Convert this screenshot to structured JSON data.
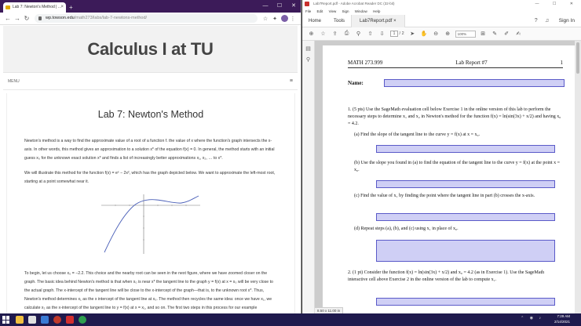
{
  "browser": {
    "tab_title": "Lab 7: Newton's Method | ...",
    "tab_close": "×",
    "new_tab": "+",
    "url_host": "wp.towson.edu",
    "url_path": "/math273/labs/lab-7-newtons-method/",
    "win_min": "—",
    "win_max": "☐",
    "win_close": "✕"
  },
  "site": {
    "title": "Calculus I at TU",
    "menu_label": "MENU"
  },
  "lab": {
    "title": "Lab 7: Newton's Method",
    "p1": "Newton's method is a way to find the approximate value of a root of a function f. the value of x where the function's graph intersects the x-axis. In other words, this method gives an approximation to a solution x* of the equation f(x) = 0. In general, the method starts with an initial guess x₀ for the unknown exact solution x* and finds a list of increasingly better approximations x₁, x₂, … to x*.",
    "p2": "We will illustrate this method for the function f(x) = eˣ − 2x², which has the graph depicted below. We want to approximate the left-most root, starting at a point somewhat near it.",
    "p3": "To begin, let us choose x₀ = −2.2. This choice and the nearby root can be seen in the next figure, where we have zoomed closer on the graph. The basic idea behind Newton's method is that when x₀ is near x* the tangent line to the graph y = f(x) at x = x₀ will be very close to the actual graph. The x-intercept of the tangent line will be close to the x-intercept of the graph—that is, to the unknown root x*. Thus, Newton's method determines x₁ as the x intercept of the tangent line at x₀. The method then recycles the same idea: once we have x₁, we calculate x₂ as the x-intercept of the tangent line to y = f(x) at x = x₁, and so on. The first two steps in this process for our example"
  },
  "acrobat": {
    "window_title": "Lab7Report.pdf - Adobe Acrobat Reader DC (32-bit)",
    "win_buttons": "— ☐ ✕",
    "menus": [
      "File",
      "Edit",
      "View",
      "Sign",
      "Window",
      "Help"
    ],
    "tab_home": "Home",
    "tab_tools": "Tools",
    "tab_doc": "Lab7Report.pdf",
    "tab_doc_close": "×",
    "sign_in": "Sign In",
    "page_current": "1",
    "page_total": "/ 2",
    "zoom": "100%",
    "page_size": "8.50 x 11.00 in"
  },
  "pdf": {
    "course": "MATH 273.999",
    "report": "Lab Report #7",
    "page_num": "1",
    "name_label": "Name:",
    "q1": "1. (5 pts) Use the SageMath evaluation cell below Exercise 1 in the online version of this lab to perform the necessary steps to determine x₁ and x₂ in Newton's method for the function f(x) = ln(sin(3x) + x/2) and having x₀ = 4.2.",
    "q1a": "(a) Find the slope of the tangent line to the curve y = f(x) at x = x₀.",
    "q1b": "(b) Use the slope you found in (a) to find the equation of the tangent line to the curve y = f(x) at the point x = x₀.",
    "q1c": "(c) Find the value of x₁ by finding the point where the tangent line in part (b) crosses the x-axis.",
    "q1d": "(d) Repeat steps (a), (b), and (c) using x₁ in place of x₀.",
    "q2": "2. (1 pt) Consider the function f(x) = ln(sin(3x) + x/2) and x₀ = 4.2 (as in Exercise 1). Use the SageMath interactive cell above Exercise 2 in the online version of the lab to compute x₁."
  },
  "taskbar": {
    "time": "7:29 AM",
    "date": "2/14/2021"
  },
  "colors": {
    "chrome_frame": "#3c1b59",
    "field_fill": "#cfcff5",
    "field_border": "#5a5ac8",
    "taskbar": "#1f1a4d"
  }
}
